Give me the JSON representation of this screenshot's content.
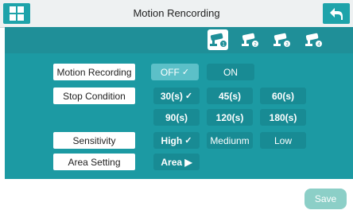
{
  "header": {
    "title": "Motion Rencording"
  },
  "cameras": [
    {
      "icon": "camera-1-icon",
      "active": true
    },
    {
      "icon": "camera-2-icon",
      "active": false
    },
    {
      "icon": "camera-3-icon",
      "active": false
    },
    {
      "icon": "camera-4-icon",
      "active": false
    }
  ],
  "motion_recording": {
    "label": "Motion Recording",
    "options": [
      "OFF",
      "ON"
    ],
    "selected": "OFF"
  },
  "stop_condition": {
    "label": "Stop Condition",
    "options": [
      "30(s)",
      "45(s)",
      "60(s)",
      "90(s)",
      "120(s)",
      "180(s)"
    ],
    "selected": "30(s)"
  },
  "sensitivity": {
    "label": "Sensitivity",
    "options": [
      "High",
      "Mediunm",
      "Low"
    ],
    "selected": "High"
  },
  "area_setting": {
    "label": "Area Setting",
    "button": "Area ▶"
  },
  "footer": {
    "save_label": "Save"
  },
  "colors": {
    "accent": "#1ea3aa",
    "panel": "#1c9aa3",
    "option": "#188b94",
    "selected": "#5cc0c8",
    "save": "#8ccfc7"
  }
}
